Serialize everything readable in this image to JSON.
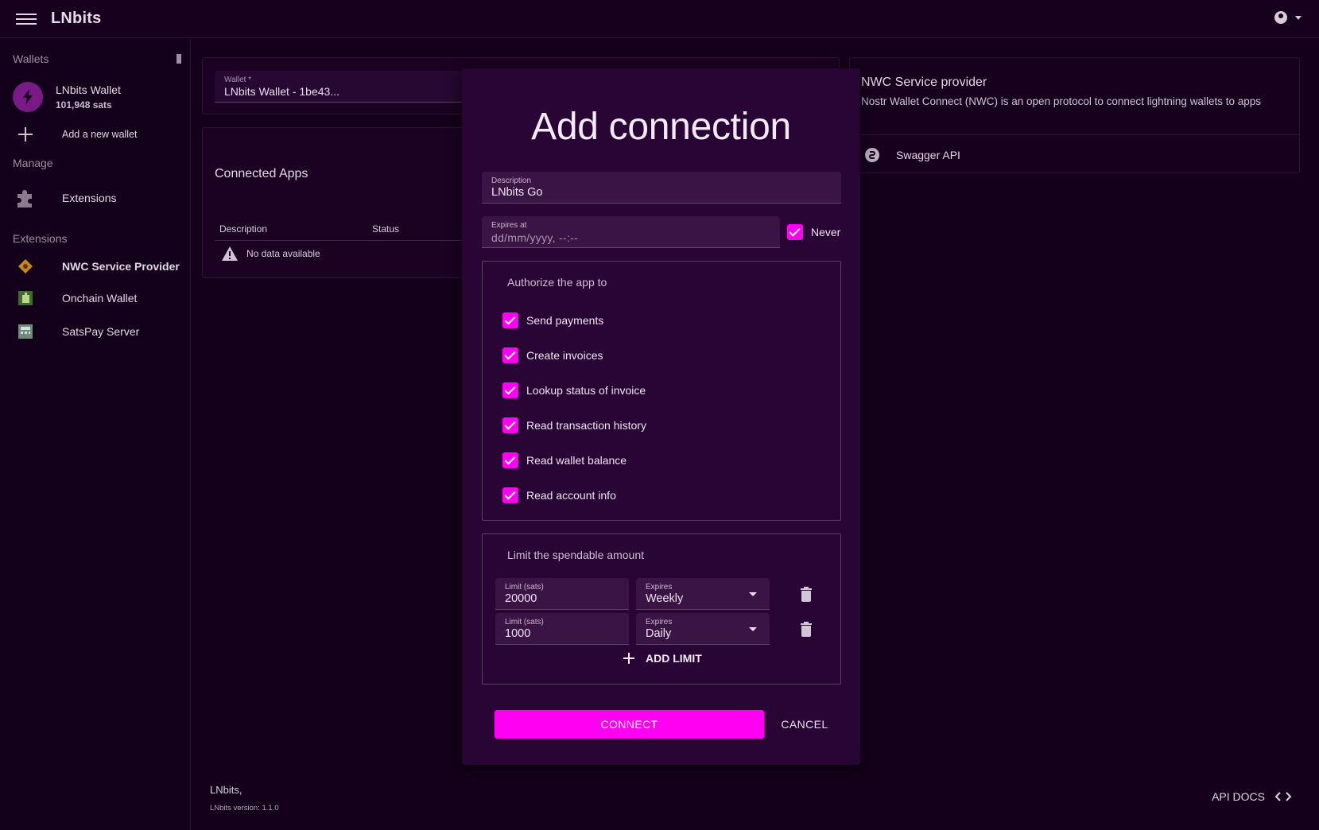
{
  "app": {
    "title": "LNbits"
  },
  "sidebar": {
    "wallets_heading": "Wallets",
    "wallet": {
      "name": "LNbits Wallet",
      "balance": "101,948 sats"
    },
    "add_wallet": "Add a new wallet",
    "manage_heading": "Manage",
    "manage_items": [
      {
        "label": "Extensions",
        "icon": "puzzle-icon"
      }
    ],
    "extensions_heading": "Extensions",
    "extension_items": [
      {
        "label": "NWC Service Provider",
        "icon": "nwc-icon",
        "active": true
      },
      {
        "label": "Onchain Wallet",
        "icon": "onchain-icon"
      },
      {
        "label": "SatsPay Server",
        "icon": "satspay-icon"
      }
    ]
  },
  "main": {
    "wallet_select": {
      "label": "Wallet *",
      "value": "LNbits Wallet - 1be43..."
    },
    "connected_apps": {
      "title": "Connected Apps",
      "columns": [
        "Description",
        "Status"
      ],
      "empty_text": "No data available"
    }
  },
  "info_card": {
    "title": "NWC Service provider",
    "description": "Nostr Wallet Connect (NWC) is an open protocol to connect lightning wallets to apps",
    "link": "Swagger API"
  },
  "footer": {
    "name": "LNbits,",
    "version": "LNbits version: 1.1.0",
    "api_docs": "API DOCS"
  },
  "dialog": {
    "title": "Add connection",
    "description": {
      "label": "Description",
      "value": "LNbits Go"
    },
    "expires": {
      "label": "Expires at",
      "placeholder": "dd/mm/yyyy, --:--"
    },
    "never_label": "Never",
    "never_checked": true,
    "authorize_title": "Authorize the app to",
    "permissions": [
      {
        "label": "Send payments",
        "checked": true
      },
      {
        "label": "Create invoices",
        "checked": true
      },
      {
        "label": "Lookup status of invoice",
        "checked": true
      },
      {
        "label": "Read transaction history",
        "checked": true
      },
      {
        "label": "Read wallet balance",
        "checked": true
      },
      {
        "label": "Read account info",
        "checked": true
      }
    ],
    "limit_title": "Limit the spendable amount",
    "limits": [
      {
        "limit_label": "Limit (sats)",
        "limit_value": "20000",
        "expires_label": "Expires",
        "expires_value": "Weekly"
      },
      {
        "limit_label": "Limit (sats)",
        "limit_value": "1000",
        "expires_label": "Expires",
        "expires_value": "Daily"
      }
    ],
    "add_limit": "ADD LIMIT",
    "connect": "CONNECT",
    "cancel": "CANCEL"
  },
  "colors": {
    "accent": "#ff00f2",
    "background": "#14001a",
    "dialog": "#290535"
  }
}
